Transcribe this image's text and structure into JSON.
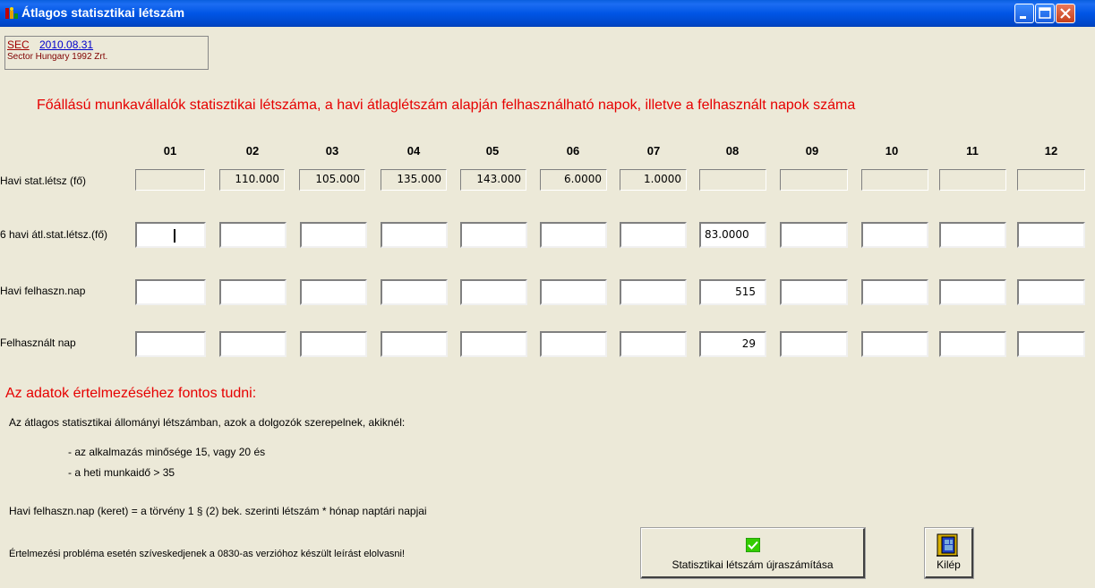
{
  "window": {
    "title": "Átlagos statisztikai létszám",
    "minimize_label": "minimize",
    "maximize_label": "maximize",
    "close_label": "close"
  },
  "company": {
    "code": "SEC",
    "date": "2010.08.31",
    "name": "Sector Hungary 1992 Zrt."
  },
  "heading": "Főállású munkavállalók statisztikai létszáma, a  havi átlaglétszám alapján felhasználható napok, illetve a felhasznált napok száma",
  "months": [
    "01",
    "02",
    "03",
    "04",
    "05",
    "06",
    "07",
    "08",
    "09",
    "10",
    "11",
    "12"
  ],
  "rows": {
    "stat_letszam": {
      "label": "Havi  stat.létsz (fő)",
      "values": [
        "",
        "110.000",
        "105.000",
        "135.000",
        "143.000",
        "6.0000",
        "1.0000",
        "",
        "",
        "",
        "",
        ""
      ]
    },
    "atl_stat_letszam": {
      "label": "6 havi átl.stat.létsz.(fő)",
      "values": [
        "",
        "",
        "",
        "",
        "",
        "",
        "",
        "83.0000",
        "",
        "",
        "",
        ""
      ]
    },
    "havi_felhasznalhato": {
      "label": "Havi felhaszn.nap",
      "values": [
        "",
        "",
        "",
        "",
        "",
        "",
        "",
        "515",
        "",
        "",
        "",
        ""
      ]
    },
    "felhasznalt_nap": {
      "label": "Felhasznált nap",
      "values": [
        "",
        "",
        "",
        "",
        "",
        "",
        "",
        "29",
        "",
        "",
        "",
        ""
      ]
    }
  },
  "info": {
    "title": "Az adatok értelmezéséhez fontos tudni:",
    "line1": "Az átlagos statisztikai állományi létszámban, azok a dolgozók szerepelnek, akiknél:",
    "bullet1": "- az alkalmazás minősége 15, vagy 20 és",
    "bullet2": "- a heti munkaidő > 35",
    "line2": "Havi felhaszn.nap (keret) = a törvény 1 § (2) bek. szerinti létszám * hónap naptári napjai",
    "line3": "Értelmezési probléma esetén szíveskedjenek a 0830-as verzióhoz készült leírást elolvasni!"
  },
  "buttons": {
    "recalc_label": "Statisztikai létszám újraszámítása",
    "exit_label": "Kilép"
  },
  "colors": {
    "title_bar": "#0055e5",
    "heading": "#e60000",
    "background": "#ece9d8",
    "check_icon": "#33cc00"
  }
}
